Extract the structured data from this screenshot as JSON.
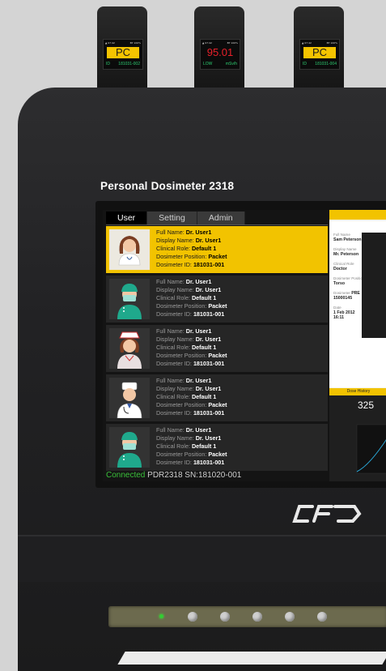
{
  "dosimeters": [
    {
      "status": [
        "▲ 07:42",
        "BT 100%"
      ],
      "value": "PC",
      "variant": "pc",
      "sub": [
        "ID",
        "181031-002"
      ]
    },
    {
      "status": [
        "▲ 07:42",
        "BT 100%"
      ],
      "value": "95.01",
      "variant": "num",
      "sub": [
        "LOW",
        "mSv/h"
      ]
    },
    {
      "status": [
        "▲ 07:42",
        "BT 100%"
      ],
      "value": "PC",
      "variant": "pc",
      "sub": [
        "ID",
        "181031-004"
      ]
    }
  ],
  "device": {
    "title": "Personal Dosimeter 2318"
  },
  "tabs": [
    {
      "label": "User"
    },
    {
      "label": "Setting"
    },
    {
      "label": "Admin"
    }
  ],
  "labels": {
    "full_name": "Full Name: ",
    "display_name": "Display Name: ",
    "clinical_role": "Clinical Role: ",
    "position": "Dosimeter Position: ",
    "dosimeter_id": "Dosimeter ID: "
  },
  "users": [
    {
      "full_name": "Dr. User1",
      "display_name": "Dr. User1",
      "clinical_role": "Default 1",
      "position": "Packet",
      "dosimeter_id": "181031-001",
      "avatar": "female-doctor"
    },
    {
      "full_name": "Dr. User1",
      "display_name": "Dr. User1",
      "clinical_role": "Default 1",
      "position": "Packet",
      "dosimeter_id": "181031-001",
      "avatar": "surgeon"
    },
    {
      "full_name": "Dr. User1",
      "display_name": "Dr. User1",
      "clinical_role": "Default 1",
      "position": "Packet",
      "dosimeter_id": "181031-001",
      "avatar": "nurse"
    },
    {
      "full_name": "Dr. User1",
      "display_name": "Dr. User1",
      "clinical_role": "Default 1",
      "position": "Packet",
      "dosimeter_id": "181031-001",
      "avatar": "doctor"
    },
    {
      "full_name": "Dr. User1",
      "display_name": "Dr. User1",
      "clinical_role": "Default 1",
      "position": "Packet",
      "dosimeter_id": "181031-001",
      "avatar": "surgeon"
    }
  ],
  "status": {
    "connected": "Connected",
    "device": "PDR2318 SN:181020-001"
  },
  "detail": {
    "full_name_label": "Full Name",
    "full_name": "Sam Peterson",
    "display_name_label": "Display Name",
    "display_name": "Mr. Peterson",
    "role_label": "Clinical Role",
    "role": "Doctor",
    "position_label": "Dosimeter Position",
    "position": "Torso",
    "dosimeter_label": "Dosimeter",
    "dosimeter_tag": "PRE",
    "dosimeter": "15000145",
    "date_label": "Date",
    "date": "1 Feb 2012",
    "time": "16:11"
  },
  "history": {
    "title": "Dose History",
    "value": "325"
  },
  "brand_colors": {
    "accent": "#f2c300",
    "connected": "#3ac13a"
  }
}
